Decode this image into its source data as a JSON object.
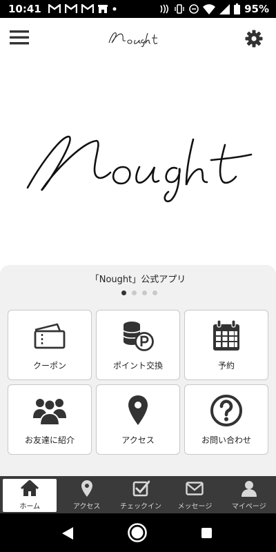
{
  "status_bar": {
    "time": "10:41",
    "battery_text": "95%",
    "left_icons": [
      "gmail-icon",
      "gmail-icon",
      "gmail-icon",
      "store-icon",
      "dot-icon"
    ],
    "right_icons": [
      "nfc-icon",
      "vibrate-icon",
      "minus-icon",
      "wifi-icon",
      "signal-icon",
      "battery-icon"
    ]
  },
  "header": {
    "logo_text": "Nought",
    "menu_icon": "hamburger-icon",
    "settings_icon": "gear-icon"
  },
  "hero": {
    "logo_text": "Nought"
  },
  "app_title": "「Nought」公式アプリ",
  "carousel": {
    "count": 4,
    "active": 0
  },
  "tiles": [
    {
      "label": "クーポン",
      "icon": "ticket-icon"
    },
    {
      "label": "ポイント交換",
      "icon": "coins-icon"
    },
    {
      "label": "予約",
      "icon": "calendar-icon"
    },
    {
      "label": "お友達に紹介",
      "icon": "group-icon"
    },
    {
      "label": "アクセス",
      "icon": "map-pin-icon"
    },
    {
      "label": "お問い合わせ",
      "icon": "question-icon"
    }
  ],
  "bottom_nav": [
    {
      "label": "ホーム",
      "icon": "home-icon",
      "active": true
    },
    {
      "label": "アクセス",
      "icon": "map-pin-icon",
      "active": false
    },
    {
      "label": "チェックイン",
      "icon": "checkbox-icon",
      "active": false
    },
    {
      "label": "メッセージ",
      "icon": "envelope-icon",
      "active": false
    },
    {
      "label": "マイページ",
      "icon": "person-icon",
      "active": false
    }
  ],
  "colors": {
    "status_bar": "#000000",
    "panel_background": "#f1f1f1",
    "bottom_nav": "#3a3a3a",
    "icon_dark": "#333333"
  }
}
